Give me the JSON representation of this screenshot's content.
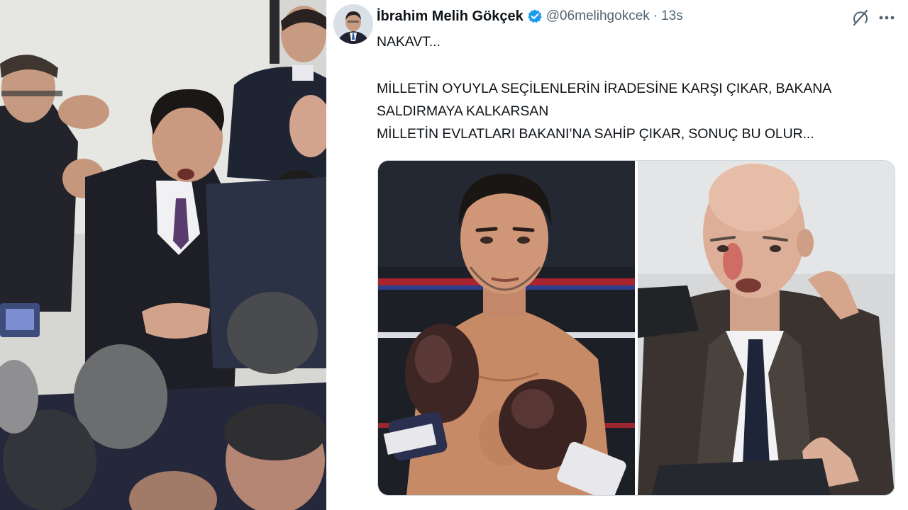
{
  "tweet": {
    "author_name": "İbrahim Melih Gökçek",
    "handle": "@06melihgokcek",
    "separator": "·",
    "time": "13s",
    "text_lines": [
      "NAKAVT...",
      "MİLLETİN OYUYLA SEÇİLENLERİN İRADESİNE KARŞI ÇIKAR, BAKANA",
      "SALDIRMAYA KALKARSAN",
      "MİLLETİN EVLATLARI BAKANI’NA SAHİP ÇIKAR, SONUÇ BU OLUR..."
    ]
  },
  "icons": {
    "verified": "verified-badge-icon",
    "grok": "grok-icon",
    "more": "more-icon"
  },
  "colors": {
    "verified_blue": "#1d9bf0",
    "name_text": "#0f1419",
    "secondary_text": "#536471"
  }
}
